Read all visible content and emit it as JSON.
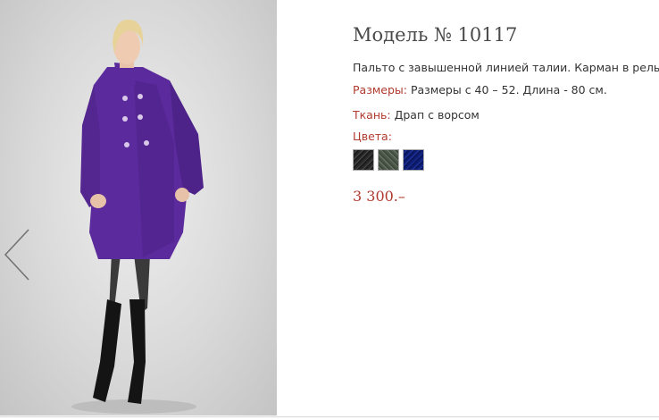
{
  "product": {
    "title": "Модель № 10117",
    "description": "Пальто с завышенной линией талии. Карман в рельефе.",
    "sizes_label": "Размеры:",
    "sizes_value": "Размеры с 40 – 52. Длина - 80 см.",
    "fabric_label": "Ткань:",
    "fabric_value": "Драп с ворсом",
    "colors_label": "Цвета:",
    "colors": [
      {
        "name": "black",
        "hex": "#2a2a2a"
      },
      {
        "name": "green-grey",
        "hex": "#5a6657"
      },
      {
        "name": "navy-blue",
        "hex": "#1a2a8a"
      }
    ],
    "price": "3 300.–"
  },
  "gallery": {
    "prev_icon": "chevron-left-icon",
    "coat_color": "#5b2a9c"
  },
  "accent_color": "#b03a2e"
}
